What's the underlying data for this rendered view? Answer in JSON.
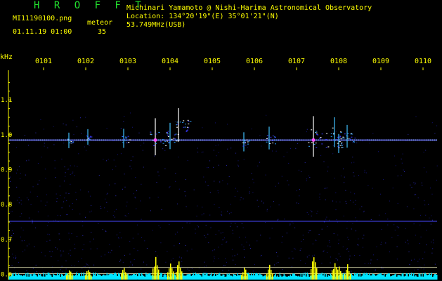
{
  "header": {
    "logo": "H R O F F T",
    "file_name": "MI11190100.png",
    "meteor_label": "meteor",
    "meteor_count": "35",
    "datetime": "01.11.19 01:00",
    "observer": "Michinari Yamamoto @ Nishi-Harima Astronomical Observatory",
    "location": "Location: 134°20'19\"(E) 35°01'21\"(N)",
    "frequency": "53.749MHz(USB)"
  },
  "colors": {
    "background": "#000000",
    "text": "#ffff00",
    "logo": "#22e02e",
    "grid": "#ffff00",
    "noise_floor": "#00e5ff"
  },
  "chart_data": {
    "type": "heatmap",
    "title": "",
    "ylabel": "kHz",
    "y_ticks": [
      "1.1",
      "1.0",
      "0.9",
      "0.8",
      "0.7",
      "0.6"
    ],
    "y_tick_values": [
      1.1,
      1.0,
      0.9,
      0.8,
      0.7,
      0.6
    ],
    "ylim": [
      0.585,
      1.185
    ],
    "x_ticks": [
      "0101",
      "0102",
      "0103",
      "0104",
      "0105",
      "0106",
      "0107",
      "0108",
      "0109",
      "0110"
    ],
    "xlim": [
      0,
      10
    ],
    "carrier_khz": 0.985,
    "reference_lines_khz": [
      0.752,
      0.62,
      0.602
    ],
    "meteor_events": [
      {
        "t": 0.6,
        "khz": 0.98,
        "strength": 0.3
      },
      {
        "t": 1.05,
        "khz": 0.99,
        "strength": 0.3
      },
      {
        "t": 1.9,
        "khz": 0.985,
        "strength": 0.4
      },
      {
        "t": 2.65,
        "khz": 0.985,
        "strength": 0.9
      },
      {
        "t": 3.0,
        "khz": 0.99,
        "strength": 0.6
      },
      {
        "t": 3.2,
        "khz": 1.02,
        "strength": 0.8
      },
      {
        "t": 4.75,
        "khz": 0.975,
        "strength": 0.4
      },
      {
        "t": 5.35,
        "khz": 0.985,
        "strength": 0.5
      },
      {
        "t": 6.4,
        "khz": 0.985,
        "strength": 1.0
      },
      {
        "t": 6.9,
        "khz": 1.0,
        "strength": 0.7
      },
      {
        "t": 7.0,
        "khz": 0.97,
        "strength": 0.4
      },
      {
        "t": 7.2,
        "khz": 0.99,
        "strength": 0.5
      },
      {
        "t": 9.55,
        "khz": 0.985,
        "strength": 0.3
      }
    ]
  }
}
